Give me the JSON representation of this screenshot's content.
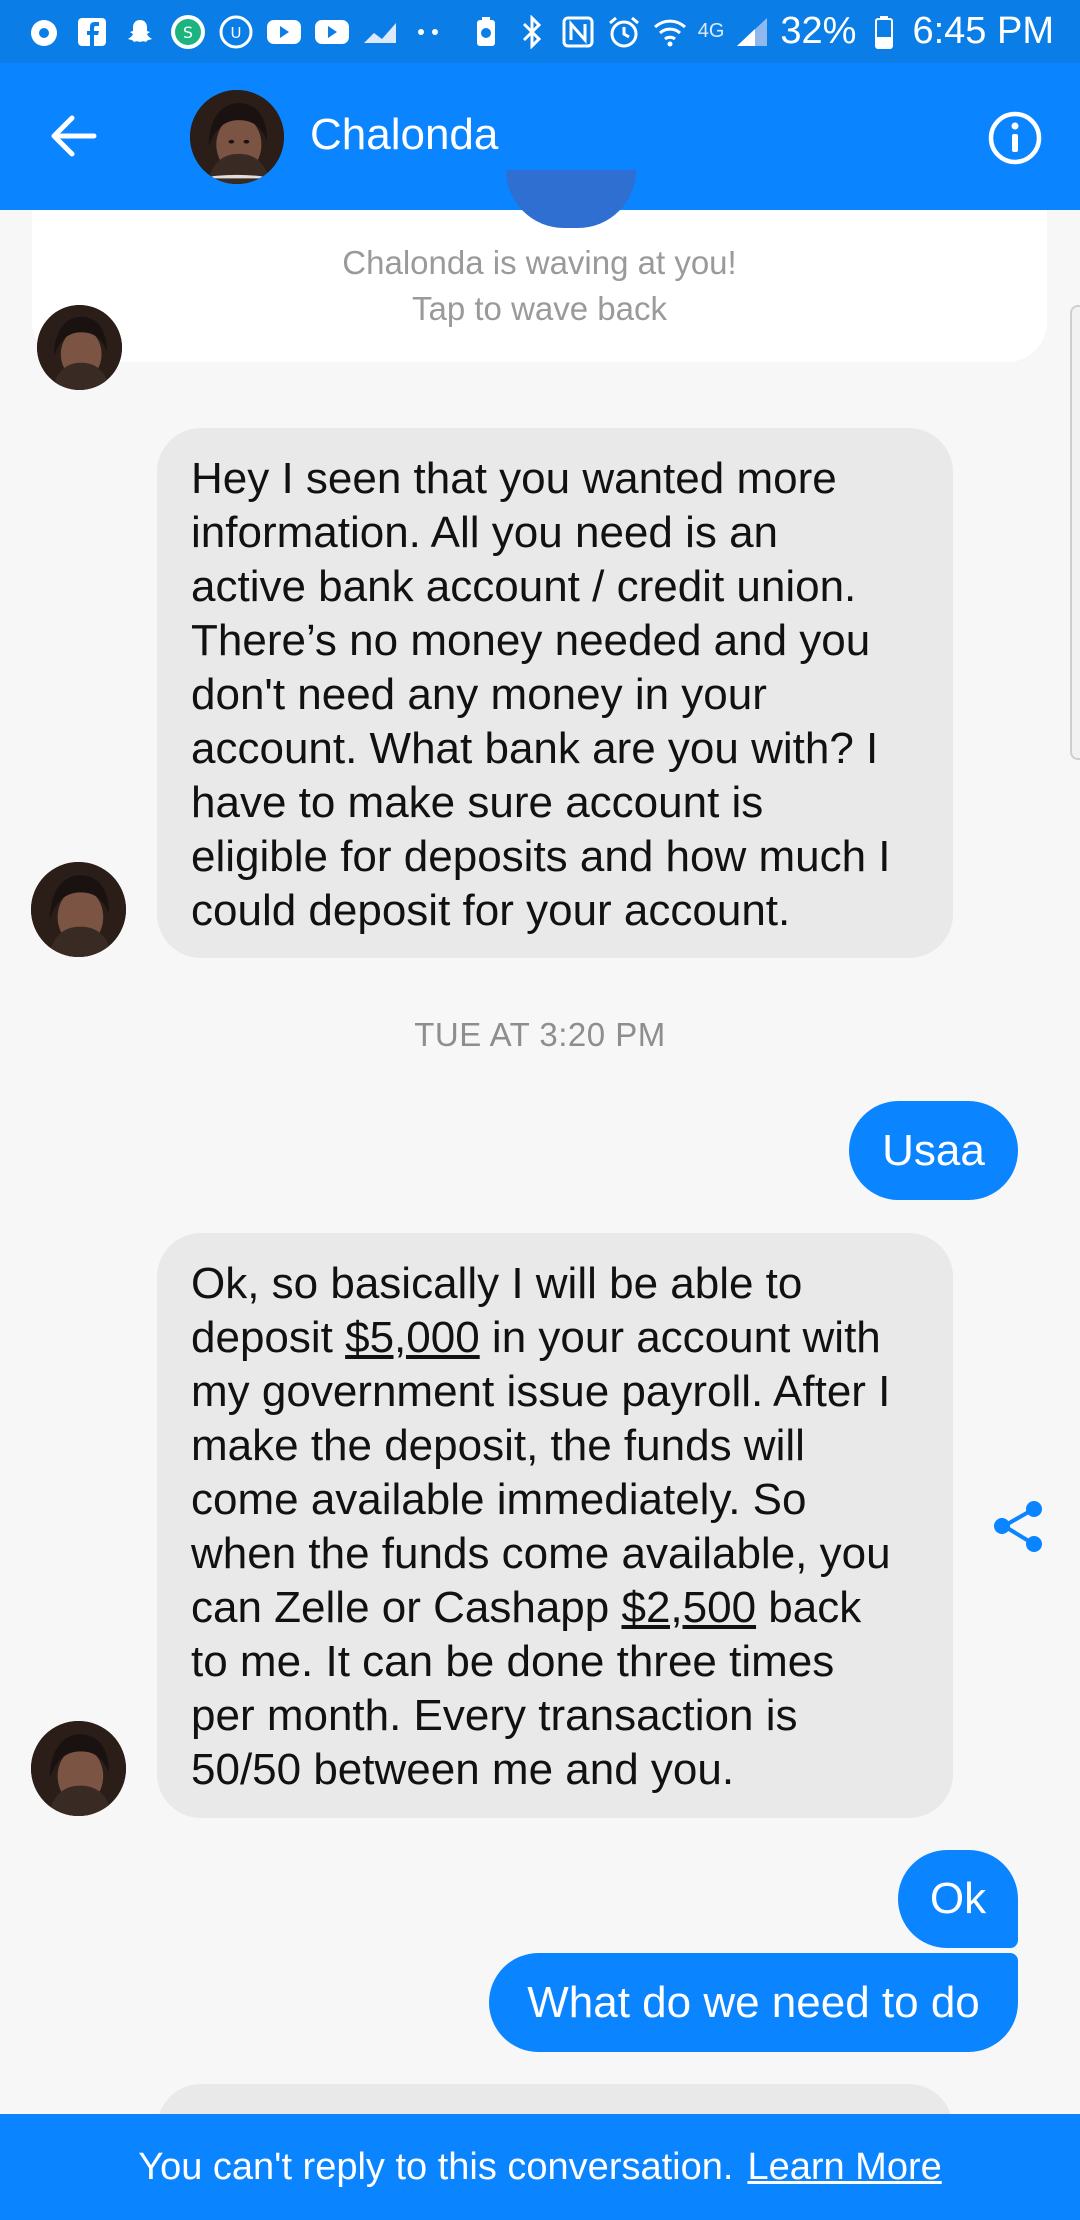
{
  "status_bar": {
    "network": "4G",
    "battery": "32%",
    "time": "6:45 PM",
    "left_icons": [
      "nav-icon",
      "facebook-icon",
      "snapchat-icon",
      "app-icon",
      "app-icon",
      "youtube-icon",
      "youtube-icon",
      "chart-icon",
      "dots-icon"
    ],
    "right_icons": [
      "battery-saver-icon",
      "bluetooth-icon",
      "nfc-icon",
      "alarm-icon",
      "wifi-icon",
      "signal-icon",
      "battery-icon"
    ]
  },
  "header": {
    "contact_name": "Chalonda",
    "colors": {
      "bar": "#0a84ff",
      "status": "#0a7ee6"
    }
  },
  "wave": {
    "line1": "Chalonda is waving at you!",
    "line2": "Tap to wave back"
  },
  "messages": {
    "msg1": {
      "lines": [
        "Hey I seen that you wanted more",
        "information. All you need is an",
        "active bank account / credit union.",
        "There’s no money needed and you",
        "don't need any money in your",
        "account. What bank are you with? I",
        "have to make sure account is",
        "eligible for deposits and how much I",
        "could deposit for your account."
      ]
    },
    "timestamp": "TUE AT 3:20 PM",
    "reply1": "Usaa",
    "msg2": {
      "line1": "Ok, so basically I will be able to",
      "line2_pre": "deposit ",
      "amount1": "$5,000",
      "line2_post": " in your account with",
      "line3": "my government issue payroll. After I",
      "line4": "make the deposit, the funds will",
      "line5": "come available immediately. So",
      "line6": "when the funds come available, you",
      "line7_pre": "can Zelle or Cashapp ",
      "amount2": "$2,500",
      "line7_post": " back",
      "line8": "to me. It can be done three times",
      "line9": "per month. Every transaction is",
      "line10": "50/50 between me and you."
    },
    "reply2": "Ok",
    "reply3": "What do we need to do"
  },
  "footer": {
    "notice": "You can't reply to this conversation.",
    "link": "Learn More"
  }
}
